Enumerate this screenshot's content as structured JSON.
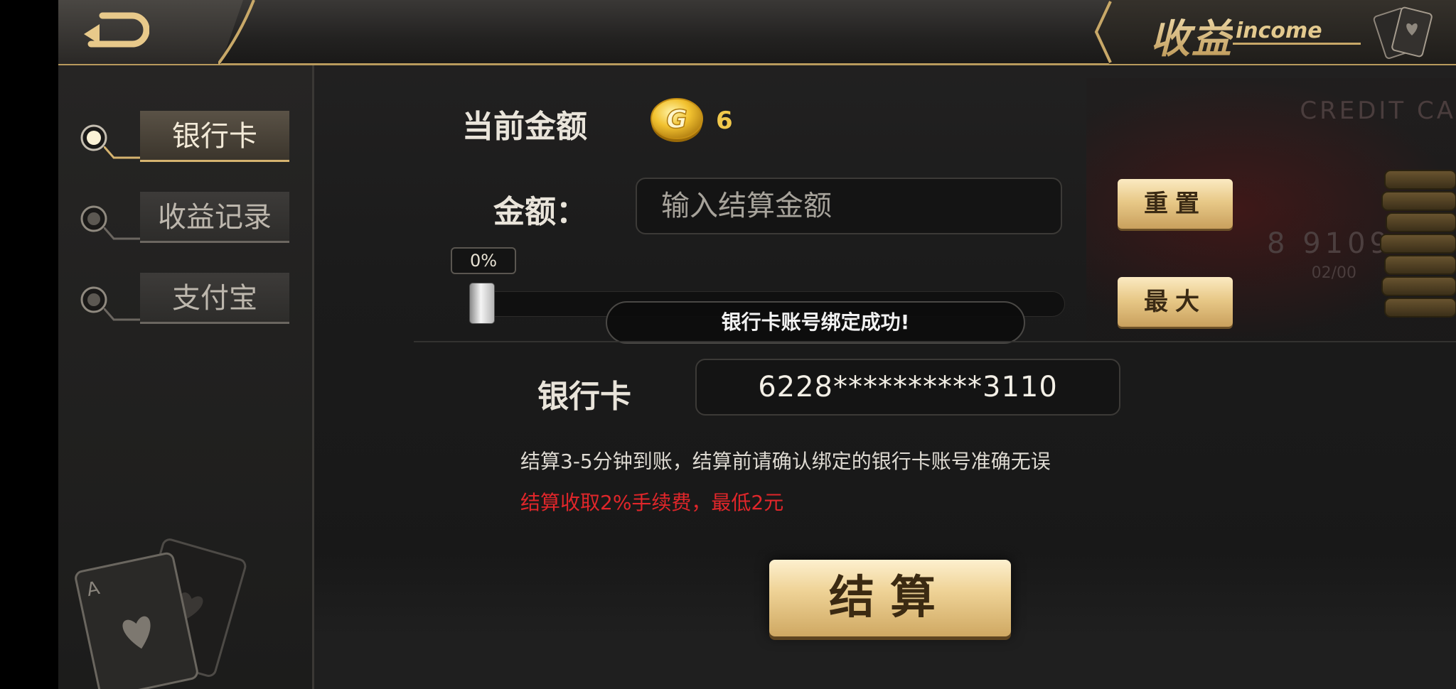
{
  "header": {
    "title_cn": "收益",
    "title_en": "income"
  },
  "sidebar": {
    "items": [
      {
        "label": "银行卡",
        "active": true
      },
      {
        "label": "收益记录",
        "active": false
      },
      {
        "label": "支付宝",
        "active": false
      }
    ]
  },
  "balance": {
    "label": "当前金额",
    "value": "6",
    "currency_icon": "gold-g-coin-icon"
  },
  "amount": {
    "label": "金额：",
    "placeholder": "输入结算金额",
    "value": ""
  },
  "buttons": {
    "reset": "重置",
    "max": "最大",
    "settle": "结算"
  },
  "slider": {
    "percent_label": "0%",
    "value_fraction": 0
  },
  "toast": {
    "message": "银行卡账号绑定成功!"
  },
  "bank_card": {
    "label": "银行卡",
    "number": "6228**********3110"
  },
  "notices": {
    "line1": "结算3-5分钟到账，结算前请确认绑定的银行卡账号准确无误",
    "line2": "结算收取2%手续费，最低2元"
  },
  "decor": {
    "credit_text": "CREDIT CA",
    "credit_number": "8 9109",
    "credit_exp": "02/00"
  },
  "colors": {
    "gold_accent": "#d5b36f",
    "warning_red": "#e0262a",
    "coin_yellow": "#f2c94c"
  }
}
